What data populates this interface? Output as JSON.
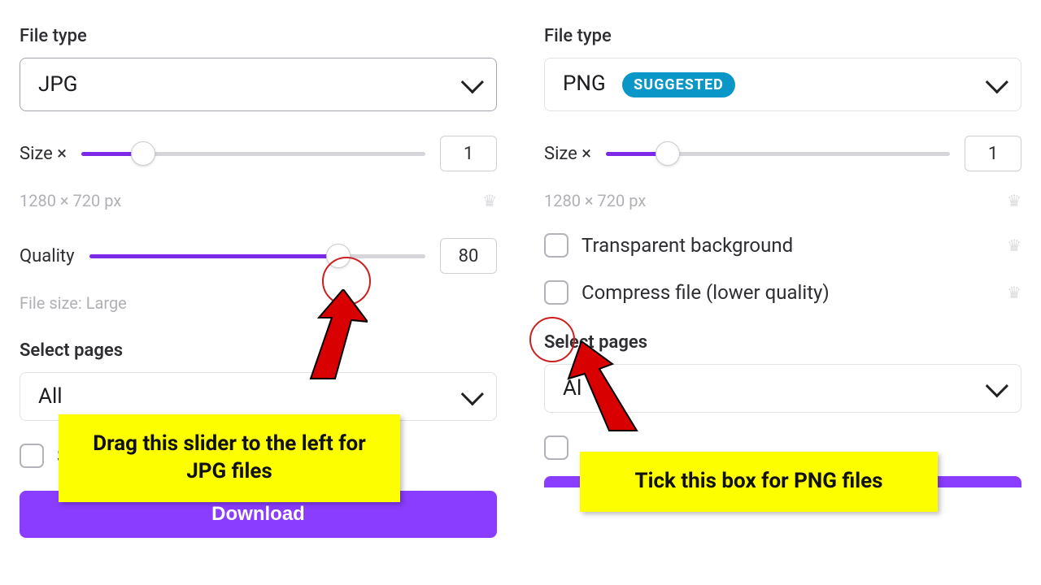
{
  "leftPanel": {
    "fileTypeLabel": "File type",
    "fileTypeValue": "JPG",
    "sizeLabel": "Size ×",
    "sizeValue": "1",
    "sizeFillPercent": 18,
    "dimensions": "1280 × 720 px",
    "qualityLabel": "Quality",
    "qualityValue": "80",
    "qualityFillPercent": 74,
    "fileSizeHint": "File size: Large",
    "selectPagesLabel": "Select pages",
    "selectPagesValue": "All",
    "downloadLabel": "Download",
    "calloutText": "Drag this slider to the left for JPG files"
  },
  "rightPanel": {
    "fileTypeLabel": "File type",
    "fileTypeValue": "PNG",
    "suggestedBadge": "SUGGESTED",
    "sizeLabel": "Size ×",
    "sizeValue": "1",
    "sizeFillPercent": 18,
    "dimensions": "1280 × 720 px",
    "transparentLabel": "Transparent background",
    "compressLabel": "Compress file (lower quality)",
    "selectPagesLabel": "Select pages",
    "selectPagesValue": "Al",
    "calloutText": "Tick this box for PNG files"
  }
}
